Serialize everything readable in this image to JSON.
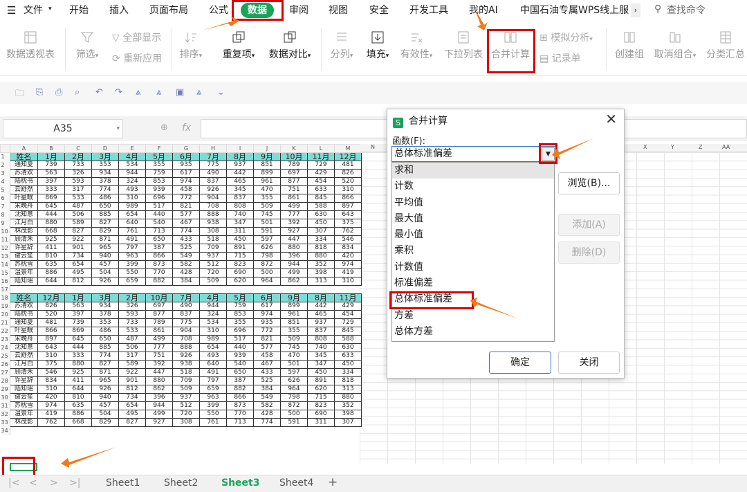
{
  "menu": {
    "file": "文件",
    "items": [
      "开始",
      "插入",
      "页面布局",
      "公式",
      "数据",
      "审阅",
      "视图",
      "安全",
      "开发工具",
      "我的AI",
      "中国石油专属WPS线上服"
    ],
    "search": "查找命令"
  },
  "ribbon": {
    "pivot": "数据透视表",
    "filter": "筛选",
    "show_all": "全部显示",
    "reapply": "重新应用",
    "sort": "排序",
    "duplicates": "重复项",
    "compare": "数据对比",
    "split": "分列",
    "fill": "填充",
    "validity": "有效性",
    "dropdown_list": "下拉列表",
    "consolidate": "合并计算",
    "simulate": "模拟分析",
    "record": "记录单",
    "group": "创建组",
    "ungroup": "取消组合",
    "subtotal": "分类汇总"
  },
  "name_box": "A35",
  "fx": "fx",
  "columns": [
    "A",
    "B",
    "C",
    "D",
    "E",
    "F",
    "G",
    "H",
    "I",
    "J",
    "K",
    "L",
    "M",
    "N",
    "O",
    "P",
    "Q",
    "R",
    "S",
    "T",
    "U",
    "V",
    "W",
    "X",
    "Y",
    "Z",
    "AA"
  ],
  "table1": {
    "header": [
      "姓名",
      "1月",
      "2月",
      "3月",
      "4月",
      "5月",
      "6月",
      "7月",
      "8月",
      "9月",
      "10月",
      "11月",
      "12月"
    ],
    "rows": [
      [
        "通知夏",
        "739",
        "733",
        "353",
        "534",
        "355",
        "935",
        "775",
        "937",
        "851",
        "789",
        "729",
        "481"
      ],
      [
        "苏清欢",
        "563",
        "326",
        "934",
        "944",
        "759",
        "617",
        "490",
        "442",
        "899",
        "697",
        "429",
        "826"
      ],
      [
        "陆枕书",
        "397",
        "593",
        "378",
        "324",
        "853",
        "974",
        "837",
        "465",
        "961",
        "877",
        "454",
        "520"
      ],
      [
        "云舒然",
        "333",
        "317",
        "774",
        "493",
        "939",
        "458",
        "926",
        "345",
        "470",
        "751",
        "633",
        "310"
      ],
      [
        "叶星眠",
        "869",
        "533",
        "486",
        "310",
        "696",
        "772",
        "904",
        "837",
        "355",
        "861",
        "845",
        "866"
      ],
      [
        "宋晚舟",
        "645",
        "487",
        "650",
        "989",
        "517",
        "821",
        "708",
        "808",
        "509",
        "499",
        "588",
        "897"
      ],
      [
        "沈知意",
        "444",
        "506",
        "885",
        "654",
        "440",
        "577",
        "888",
        "740",
        "745",
        "777",
        "630",
        "643"
      ],
      [
        "江月白",
        "880",
        "589",
        "827",
        "640",
        "540",
        "467",
        "938",
        "347",
        "501",
        "392",
        "450",
        "375"
      ],
      [
        "林茂影",
        "668",
        "827",
        "829",
        "761",
        "713",
        "774",
        "308",
        "311",
        "591",
        "927",
        "307",
        "762"
      ],
      [
        "顾清禾",
        "925",
        "922",
        "871",
        "491",
        "650",
        "433",
        "518",
        "450",
        "597",
        "447",
        "334",
        "546"
      ],
      [
        "许星辞",
        "411",
        "901",
        "965",
        "797",
        "387",
        "525",
        "709",
        "891",
        "626",
        "880",
        "818",
        "834"
      ],
      [
        "谢云笙",
        "810",
        "734",
        "940",
        "963",
        "866",
        "549",
        "937",
        "715",
        "798",
        "396",
        "880",
        "420"
      ],
      [
        "苏枕雪",
        "635",
        "654",
        "457",
        "399",
        "873",
        "582",
        "512",
        "823",
        "872",
        "944",
        "352",
        "974"
      ],
      [
        "温景年",
        "886",
        "495",
        "504",
        "550",
        "770",
        "428",
        "720",
        "690",
        "500",
        "499",
        "398",
        "419"
      ],
      [
        "陆知瑶",
        "644",
        "812",
        "926",
        "659",
        "882",
        "384",
        "509",
        "620",
        "964",
        "862",
        "313",
        "310"
      ]
    ]
  },
  "table2": {
    "header": [
      "姓名",
      "12月",
      "1月",
      "3月",
      "2月",
      "10月",
      "7月",
      "4月",
      "5月",
      "6月",
      "9月",
      "8月",
      "11月"
    ],
    "rows": [
      [
        "苏清欢",
        "826",
        "563",
        "934",
        "326",
        "697",
        "490",
        "944",
        "759",
        "617",
        "899",
        "442",
        "429"
      ],
      [
        "陆枕书",
        "520",
        "397",
        "378",
        "593",
        "877",
        "837",
        "324",
        "853",
        "974",
        "961",
        "465",
        "454"
      ],
      [
        "通知夏",
        "481",
        "739",
        "353",
        "733",
        "789",
        "775",
        "534",
        "355",
        "935",
        "851",
        "937",
        "729"
      ],
      [
        "叶星眠",
        "866",
        "869",
        "486",
        "533",
        "861",
        "904",
        "310",
        "696",
        "772",
        "355",
        "837",
        "845"
      ],
      [
        "宋晚舟",
        "897",
        "645",
        "650",
        "487",
        "499",
        "708",
        "989",
        "517",
        "821",
        "509",
        "808",
        "588"
      ],
      [
        "沈知意",
        "643",
        "444",
        "885",
        "506",
        "777",
        "888",
        "654",
        "440",
        "577",
        "745",
        "740",
        "630"
      ],
      [
        "云舒然",
        "310",
        "333",
        "774",
        "317",
        "751",
        "926",
        "493",
        "939",
        "458",
        "470",
        "345",
        "633"
      ],
      [
        "江月白",
        "375",
        "880",
        "827",
        "589",
        "392",
        "938",
        "640",
        "540",
        "467",
        "501",
        "347",
        "450"
      ],
      [
        "顾清禾",
        "546",
        "925",
        "871",
        "922",
        "447",
        "518",
        "491",
        "650",
        "433",
        "597",
        "450",
        "334"
      ],
      [
        "许星辞",
        "834",
        "411",
        "965",
        "901",
        "880",
        "709",
        "797",
        "387",
        "525",
        "626",
        "891",
        "818"
      ],
      [
        "陆知瑶",
        "310",
        "644",
        "926",
        "812",
        "862",
        "509",
        "659",
        "882",
        "384",
        "964",
        "620",
        "313"
      ],
      [
        "谢云笙",
        "420",
        "810",
        "940",
        "734",
        "396",
        "937",
        "963",
        "866",
        "549",
        "798",
        "715",
        "880"
      ],
      [
        "苏枕雪",
        "974",
        "635",
        "457",
        "654",
        "944",
        "512",
        "399",
        "873",
        "582",
        "872",
        "823",
        "352"
      ],
      [
        "温景年",
        "419",
        "886",
        "504",
        "495",
        "499",
        "720",
        "550",
        "770",
        "428",
        "500",
        "690",
        "398"
      ],
      [
        "林茂影",
        "762",
        "668",
        "829",
        "827",
        "927",
        "308",
        "761",
        "713",
        "774",
        "591",
        "311",
        "307"
      ]
    ]
  },
  "sheets": [
    "Sheet1",
    "Sheet2",
    "Sheet3",
    "Sheet4"
  ],
  "active_sheet": "Sheet3",
  "dialog": {
    "title": "合并计算",
    "logo": "S",
    "function_label": "函数(F):",
    "selected": "总体标准偏差",
    "options": [
      "求和",
      "计数",
      "平均值",
      "最大值",
      "最小值",
      "乘积",
      "计数值",
      "标准偏差",
      "总体标准偏差",
      "方差",
      "总体方差"
    ],
    "browse": "浏览(B)...",
    "add": "添加(A)",
    "delete": "删除(D)",
    "ok": "确定",
    "close": "关闭"
  },
  "colors": {
    "accent": "#1aa35a",
    "header_fill": "#7fdbd6",
    "highlight": "#d80000",
    "arrow": "#f07a1a"
  }
}
